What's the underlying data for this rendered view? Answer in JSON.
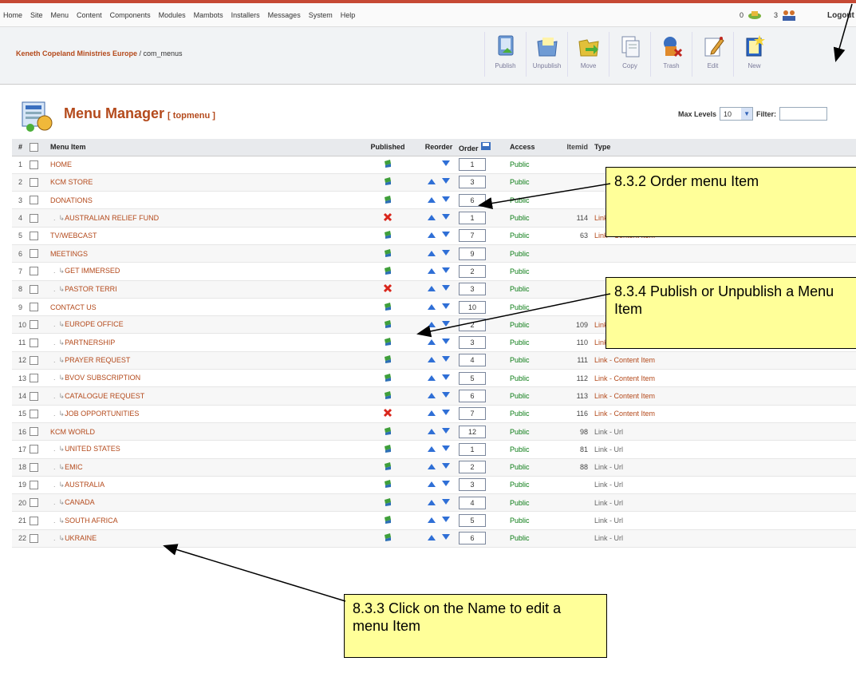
{
  "menubar": {
    "items": [
      "Home",
      "Site",
      "Menu",
      "Content",
      "Components",
      "Modules",
      "Mambots",
      "Installers",
      "Messages",
      "System",
      "Help"
    ]
  },
  "status": {
    "messages": "0",
    "users": "3",
    "logout": "Logout"
  },
  "breadcrumb": {
    "site": "Keneth Copeland Ministries Europe",
    "path": " / com_menus"
  },
  "toolbar": {
    "publish": "Publish",
    "unpublish": "Unpublish",
    "move": "Move",
    "copy": "Copy",
    "trash": "Trash",
    "edit": "Edit",
    "new": "New"
  },
  "header": {
    "title": "Menu Manager",
    "subtitle": "[ topmenu ]"
  },
  "filters": {
    "max_levels_label": "Max Levels",
    "max_levels_value": "10",
    "filter_label": "Filter:"
  },
  "table": {
    "columns": {
      "num": "#",
      "item": "Menu Item",
      "published": "Published",
      "reorder": "Reorder",
      "order": "Order",
      "access": "Access",
      "itemid": "Itemid",
      "type": "Type"
    },
    "rows": [
      {
        "n": "1",
        "name": "HOME",
        "child": false,
        "pub": true,
        "up": false,
        "order": "1",
        "access": "Public",
        "itemid": "",
        "type": ""
      },
      {
        "n": "2",
        "name": "KCM STORE",
        "child": false,
        "pub": true,
        "up": true,
        "order": "3",
        "access": "Public",
        "itemid": "",
        "type": ""
      },
      {
        "n": "3",
        "name": "DONATIONS",
        "child": false,
        "pub": true,
        "up": true,
        "order": "6",
        "access": "Public",
        "itemid": "",
        "type": ""
      },
      {
        "n": "4",
        "name": "AUSTRALIAN RELIEF FUND",
        "child": true,
        "pub": false,
        "up": true,
        "order": "1",
        "access": "Public",
        "itemid": "114",
        "type": "Link - Content Item"
      },
      {
        "n": "5",
        "name": "TV/WEBCAST",
        "child": false,
        "pub": true,
        "up": true,
        "order": "7",
        "access": "Public",
        "itemid": "63",
        "type": "Link - Content Item"
      },
      {
        "n": "6",
        "name": "MEETINGS",
        "child": false,
        "pub": true,
        "up": true,
        "order": "9",
        "access": "Public",
        "itemid": "",
        "type": ""
      },
      {
        "n": "7",
        "name": "GET IMMERSED",
        "child": true,
        "pub": true,
        "up": true,
        "order": "2",
        "access": "Public",
        "itemid": "",
        "type": ""
      },
      {
        "n": "8",
        "name": "PASTOR TERRI",
        "child": true,
        "pub": false,
        "up": true,
        "order": "3",
        "access": "Public",
        "itemid": "",
        "type": ""
      },
      {
        "n": "9",
        "name": "CONTACT US",
        "child": false,
        "pub": true,
        "up": true,
        "order": "10",
        "access": "Public",
        "itemid": "",
        "type": ""
      },
      {
        "n": "10",
        "name": "EUROPE OFFICE",
        "child": true,
        "pub": true,
        "up": true,
        "order": "2",
        "access": "Public",
        "itemid": "109",
        "type": "Link - Content Item"
      },
      {
        "n": "11",
        "name": "PARTNERSHIP",
        "child": true,
        "pub": true,
        "up": true,
        "order": "3",
        "access": "Public",
        "itemid": "110",
        "type": "Link - Content Item"
      },
      {
        "n": "12",
        "name": "PRAYER REQUEST",
        "child": true,
        "pub": true,
        "up": true,
        "order": "4",
        "access": "Public",
        "itemid": "111",
        "type": "Link - Content Item"
      },
      {
        "n": "13",
        "name": "BVOV SUBSCRIPTION",
        "child": true,
        "pub": true,
        "up": true,
        "order": "5",
        "access": "Public",
        "itemid": "112",
        "type": "Link - Content Item"
      },
      {
        "n": "14",
        "name": "CATALOGUE REQUEST",
        "child": true,
        "pub": true,
        "up": true,
        "order": "6",
        "access": "Public",
        "itemid": "113",
        "type": "Link - Content Item"
      },
      {
        "n": "15",
        "name": "JOB OPPORTUNITIES",
        "child": true,
        "pub": false,
        "up": true,
        "order": "7",
        "access": "Public",
        "itemid": "116",
        "type": "Link - Content Item"
      },
      {
        "n": "16",
        "name": "KCM WORLD",
        "child": false,
        "pub": true,
        "up": true,
        "order": "12",
        "access": "Public",
        "itemid": "98",
        "type": "Link - Url"
      },
      {
        "n": "17",
        "name": "UNITED STATES",
        "child": true,
        "pub": true,
        "up": true,
        "order": "1",
        "access": "Public",
        "itemid": "81",
        "type": "Link - Url"
      },
      {
        "n": "18",
        "name": "EMIC",
        "child": true,
        "pub": true,
        "up": true,
        "order": "2",
        "access": "Public",
        "itemid": "88",
        "type": "Link - Url"
      },
      {
        "n": "19",
        "name": "AUSTRALIA",
        "child": true,
        "pub": true,
        "up": true,
        "order": "3",
        "access": "Public",
        "itemid": "",
        "type": "Link - Url"
      },
      {
        "n": "20",
        "name": "CANADA",
        "child": true,
        "pub": true,
        "up": true,
        "order": "4",
        "access": "Public",
        "itemid": "",
        "type": "Link - Url"
      },
      {
        "n": "21",
        "name": "SOUTH AFRICA",
        "child": true,
        "pub": true,
        "up": true,
        "order": "5",
        "access": "Public",
        "itemid": "",
        "type": "Link - Url"
      },
      {
        "n": "22",
        "name": "UKRAINE",
        "child": true,
        "pub": true,
        "up": true,
        "order": "6",
        "access": "Public",
        "itemid": "",
        "type": "Link - Url"
      }
    ]
  },
  "callouts": {
    "order": "8.3.2 Order menu Item",
    "publish": "8.3.4 Publish or Unpublish a Menu Item",
    "edit": "8.3.3 Click on the Name to edit a menu Item"
  }
}
